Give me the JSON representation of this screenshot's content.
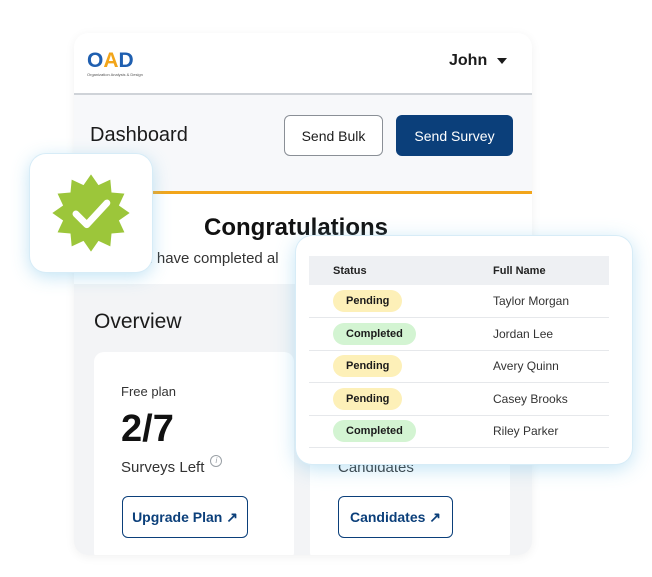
{
  "header": {
    "logo_main": {
      "o": "O",
      "a": "A",
      "d": "D"
    },
    "logo_sub": "Organization Analysis & Design",
    "user_name": "John"
  },
  "dashboard": {
    "title": "Dashboard",
    "send_bulk_label": "Send Bulk",
    "send_survey_label": "Send Survey"
  },
  "congrats": {
    "title": "Congratulations",
    "subtitle": "ou have completed al"
  },
  "overview": {
    "title": "Overview",
    "plan_card": {
      "label": "Free plan",
      "count": "2/7",
      "caption": "Surveys Left",
      "button_label": "Upgrade Plan ↗"
    },
    "candidates_card": {
      "caption": "Candidates",
      "button_label": "Candidates ↗"
    }
  },
  "status_table": {
    "headers": {
      "status": "Status",
      "full_name": "Full Name"
    },
    "rows": [
      {
        "status": "Pending",
        "status_type": "pending",
        "name": "Taylor Morgan"
      },
      {
        "status": "Completed",
        "status_type": "completed",
        "name": "Jordan Lee"
      },
      {
        "status": "Pending",
        "status_type": "pending",
        "name": "Avery Quinn"
      },
      {
        "status": "Pending",
        "status_type": "pending",
        "name": "Casey Brooks"
      },
      {
        "status": "Completed",
        "status_type": "completed",
        "name": "Riley Parker"
      }
    ]
  },
  "colors": {
    "brand_blue": "#0b3f7a",
    "accent_orange": "#f2a51a",
    "badge_green": "#9cc63a",
    "pending_bg": "#fdf0b8",
    "completed_bg": "#d3f4d2"
  },
  "icons": {
    "verified_badge": "verified-check-icon",
    "user_menu": "chevron-down-icon",
    "info": "info-icon",
    "external_link": "arrow-up-right-icon"
  }
}
